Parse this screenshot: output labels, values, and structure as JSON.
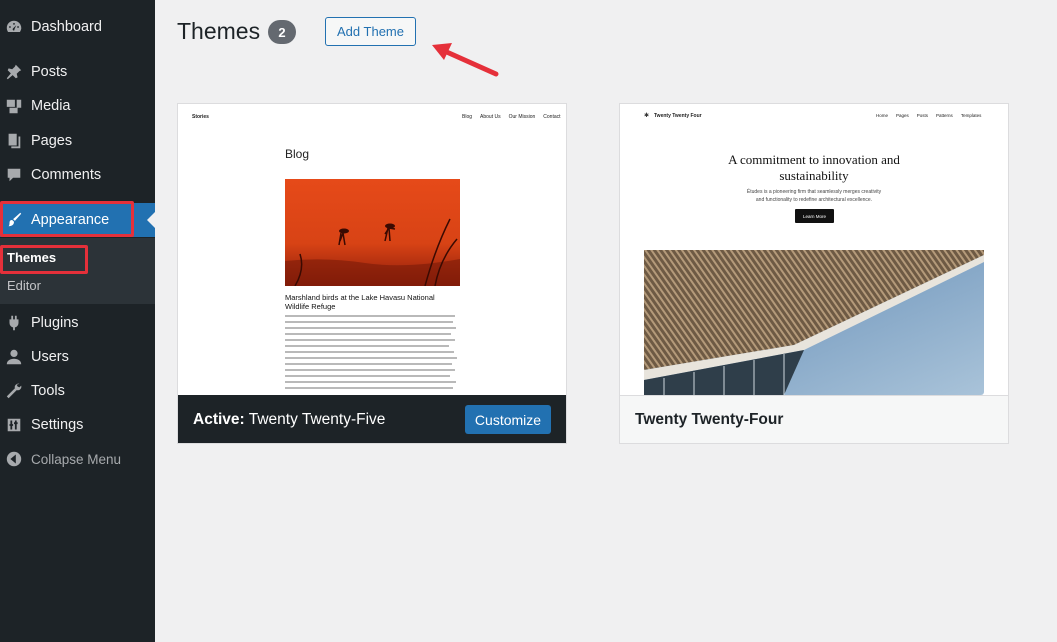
{
  "sidebar": {
    "items": [
      {
        "label": "Dashboard",
        "icon": "dashboard-icon"
      },
      {
        "label": "Posts",
        "icon": "pin-icon"
      },
      {
        "label": "Media",
        "icon": "media-icon"
      },
      {
        "label": "Pages",
        "icon": "pages-icon"
      },
      {
        "label": "Comments",
        "icon": "comment-icon"
      },
      {
        "label": "Appearance",
        "icon": "paintbrush-icon"
      },
      {
        "label": "Plugins",
        "icon": "plugin-icon"
      },
      {
        "label": "Users",
        "icon": "user-icon"
      },
      {
        "label": "Tools",
        "icon": "wrench-icon"
      },
      {
        "label": "Settings",
        "icon": "settings-icon"
      },
      {
        "label": "Collapse Menu",
        "icon": "collapse-icon"
      }
    ],
    "submenu": [
      {
        "label": "Themes"
      },
      {
        "label": "Editor"
      }
    ]
  },
  "header": {
    "title": "Themes",
    "count": "2",
    "add_label": "Add Theme"
  },
  "themes": [
    {
      "active_prefix": "Active:",
      "name": "Twenty Twenty-Five",
      "action_label": "Customize",
      "preview": {
        "site_title": "Stories",
        "nav": [
          "Blog",
          "About Us",
          "Our Mission",
          "Contact"
        ],
        "heading": "Blog",
        "post_title": "Marshland birds at the Lake Havasu National Wildlife Refuge"
      }
    },
    {
      "name": "Twenty Twenty-Four",
      "preview": {
        "site_title": "Twenty Twenty Four",
        "nav": [
          "Home",
          "Pages",
          "Posts",
          "Patterns",
          "Templates"
        ],
        "headline": "A commitment to innovation and sustainability",
        "subline": "Études is a pioneering firm that seamlessly merges creativity and functionality to redefine architectural excellence.",
        "button": "Learn More"
      }
    }
  ],
  "colors": {
    "sidebar_bg": "#1d2327",
    "accent": "#2271b1",
    "highlight": "#e5303a"
  }
}
